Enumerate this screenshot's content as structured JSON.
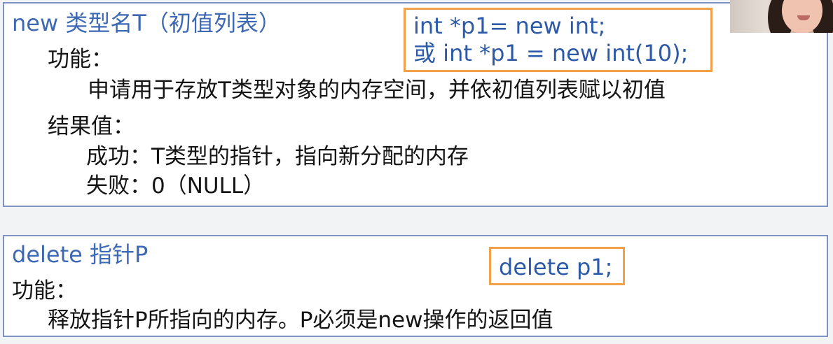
{
  "new_section": {
    "syntax": "new  类型名T（初值列表）",
    "function_label": "功能：",
    "function_text": "申请用于存放T类型对象的内存空间，并依初值列表赋以初值",
    "result_label": "结果值：",
    "success_text": "成功：T类型的指针，指向新分配的内存",
    "failure_text": "失败：0（NULL）",
    "code_line_1": "int *p1= new int;",
    "code_line_2": "或 int *p1 = new int(10);"
  },
  "delete_section": {
    "syntax": "delete 指针P",
    "function_label": "功能：",
    "function_text": "释放指针P所指向的内存。P必须是new操作的返回值",
    "code": "delete p1;"
  },
  "colors": {
    "syntax_blue": "#3d68b3",
    "border_blue": "#7d93c6",
    "callout_orange": "#f0a14a"
  }
}
